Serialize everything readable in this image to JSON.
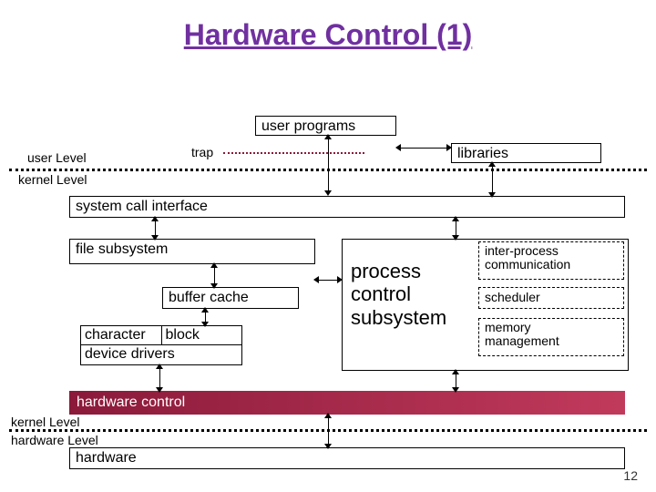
{
  "title": "Hardware Control (1)",
  "labels": {
    "user_programs": "user programs",
    "trap": "trap",
    "libraries": "libraries",
    "user_level": "user Level",
    "kernel_level_upper": "kernel Level",
    "kernel_level_lower": "kernel Level",
    "hardware_level": "hardware Level",
    "system_call_interface": "system call interface",
    "file_subsystem": "file subsystem",
    "buffer_cache": "buffer cache",
    "device_drivers": {
      "character": "character",
      "block": "block",
      "caption": "device drivers"
    },
    "process_control_subsystem": "process\ncontrol\nsubsystem",
    "ipc": "inter-process\ncommunication",
    "scheduler": "scheduler",
    "memory_management": "memory\nmanagement",
    "hardware_control": "hardware control",
    "hardware": "hardware"
  },
  "page_number": 12
}
